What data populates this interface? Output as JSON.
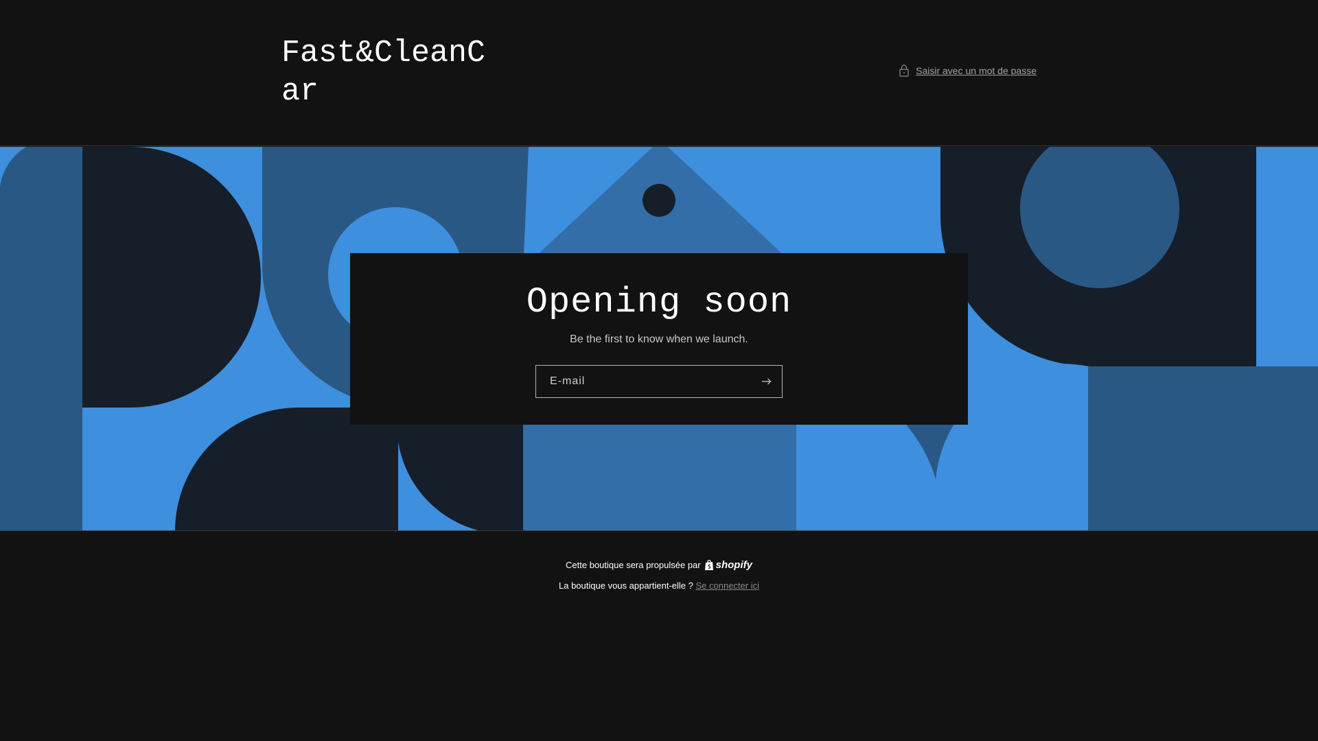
{
  "header": {
    "store_name": "Fast&CleanCar",
    "password_link": "Saisir avec un mot de passe"
  },
  "newsletter": {
    "title": "Opening soon",
    "subtitle": "Be the first to know when we launch.",
    "email_placeholder": "E-mail"
  },
  "footer": {
    "powered_text": "Cette boutique sera propulsée par",
    "shopify_label": "shopify",
    "owner_question": "La boutique vous appartient-elle ?",
    "login_link": "Se connecter ici"
  },
  "colors": {
    "background": "#121212",
    "hero_light_blue": "#3e8fdd",
    "hero_mid_blue": "#336ea8",
    "hero_dark_blue": "#2a5885",
    "hero_navy": "#161e2a"
  },
  "icons": [
    "lock-icon",
    "arrow-right-icon",
    "shopify-bag-icon"
  ]
}
